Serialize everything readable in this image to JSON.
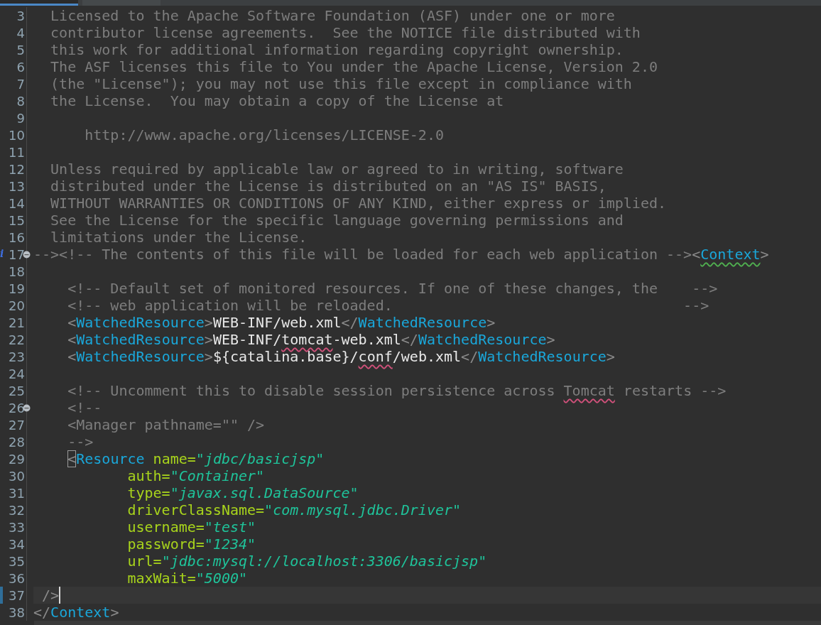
{
  "tabs": [
    {
      "selected": true
    },
    {
      "selected": false
    }
  ],
  "lines": [
    {
      "number": "3",
      "info": false,
      "fold": false,
      "current": false,
      "tokens": [
        {
          "kind": "comment",
          "t": "  Licensed to the Apache Software Foundation (ASF) under one or more"
        }
      ]
    },
    {
      "number": "4",
      "info": false,
      "fold": false,
      "current": false,
      "tokens": [
        {
          "kind": "comment",
          "t": "  contributor license agreements.  See the NOTICE file distributed with"
        }
      ]
    },
    {
      "number": "5",
      "info": false,
      "fold": false,
      "current": false,
      "tokens": [
        {
          "kind": "comment",
          "t": "  this work for additional information regarding copyright ownership."
        }
      ]
    },
    {
      "number": "6",
      "info": false,
      "fold": false,
      "current": false,
      "tokens": [
        {
          "kind": "comment",
          "t": "  The ASF licenses this file to You under the Apache License, Version 2.0"
        }
      ]
    },
    {
      "number": "7",
      "info": false,
      "fold": false,
      "current": false,
      "tokens": [
        {
          "kind": "comment",
          "t": "  (the \"License\"); you may not use this file except in compliance with"
        }
      ]
    },
    {
      "number": "8",
      "info": false,
      "fold": false,
      "current": false,
      "tokens": [
        {
          "kind": "comment",
          "t": "  the License.  You may obtain a copy of the License at"
        }
      ]
    },
    {
      "number": "9",
      "info": false,
      "fold": false,
      "current": false
    },
    {
      "number": "10",
      "info": false,
      "fold": false,
      "current": false,
      "tokens": [
        {
          "kind": "comment",
          "t": "      http://www.apache.org/licenses/LICENSE-2.0"
        }
      ]
    },
    {
      "number": "11",
      "info": false,
      "fold": false,
      "current": false
    },
    {
      "number": "12",
      "info": false,
      "fold": false,
      "current": false,
      "tokens": [
        {
          "kind": "comment",
          "t": "  Unless required by applicable law or agreed to in writing, software"
        }
      ]
    },
    {
      "number": "13",
      "info": false,
      "fold": false,
      "current": false,
      "tokens": [
        {
          "kind": "comment",
          "t": "  distributed under the License is distributed on an \"AS IS\" BASIS,"
        }
      ]
    },
    {
      "number": "14",
      "info": false,
      "fold": false,
      "current": false,
      "tokens": [
        {
          "kind": "comment",
          "t": "  WITHOUT WARRANTIES OR CONDITIONS OF ANY KIND, either express or implied."
        }
      ]
    },
    {
      "number": "15",
      "info": false,
      "fold": false,
      "current": false,
      "tokens": [
        {
          "kind": "comment",
          "t": "  See the License for the specific language governing permissions and"
        }
      ]
    },
    {
      "number": "16",
      "info": false,
      "fold": false,
      "current": false,
      "tokens": [
        {
          "kind": "comment",
          "t": "  limitations under the License."
        }
      ]
    },
    {
      "number": "17",
      "marker": "i",
      "info": true,
      "fold": true,
      "current": false,
      "tokens": [
        {
          "kind": "comment",
          "t": "--><!-- The contents of this file will be loaded for each web application -->"
        },
        {
          "kind": "punct",
          "t": "<"
        },
        {
          "kind": "tag-warn",
          "t": "Context"
        },
        {
          "kind": "punct",
          "t": ">"
        }
      ]
    },
    {
      "number": "18",
      "info": false,
      "fold": false,
      "current": false
    },
    {
      "number": "19",
      "info": false,
      "fold": false,
      "current": false,
      "tokens": [
        {
          "kind": "comment",
          "t": "    <!-- Default set of monitored resources. If one of these changes, the    -->"
        }
      ]
    },
    {
      "number": "20",
      "info": false,
      "fold": false,
      "current": false,
      "tokens": [
        {
          "kind": "comment",
          "t": "    <!-- web application will be reloaded.                                  -->"
        }
      ]
    },
    {
      "number": "21",
      "info": false,
      "fold": false,
      "current": false,
      "tokens": [
        {
          "kind": "punct",
          "t": "    <"
        },
        {
          "kind": "tag",
          "t": "WatchedResource"
        },
        {
          "kind": "punct",
          "t": ">"
        },
        {
          "kind": "text",
          "t": "WEB-INF/web.xml"
        },
        {
          "kind": "punct",
          "t": "</"
        },
        {
          "kind": "tag",
          "t": "WatchedResource"
        },
        {
          "kind": "punct",
          "t": ">"
        }
      ]
    },
    {
      "number": "22",
      "info": false,
      "fold": false,
      "current": false,
      "tokens": [
        {
          "kind": "punct",
          "t": "    <"
        },
        {
          "kind": "tag",
          "t": "WatchedResource"
        },
        {
          "kind": "punct",
          "t": ">"
        },
        {
          "kind": "text",
          "t": "WEB-INF/"
        },
        {
          "kind": "text-warn",
          "t": "tomcat"
        },
        {
          "kind": "text",
          "t": "-web.xml"
        },
        {
          "kind": "punct",
          "t": "</"
        },
        {
          "kind": "tag",
          "t": "WatchedResource"
        },
        {
          "kind": "punct",
          "t": ">"
        }
      ]
    },
    {
      "number": "23",
      "info": false,
      "fold": false,
      "current": false,
      "tokens": [
        {
          "kind": "punct",
          "t": "    <"
        },
        {
          "kind": "tag",
          "t": "WatchedResource"
        },
        {
          "kind": "punct",
          "t": ">"
        },
        {
          "kind": "text",
          "t": "${catalina.base}/"
        },
        {
          "kind": "text-warn",
          "t": "conf"
        },
        {
          "kind": "text",
          "t": "/web.xml"
        },
        {
          "kind": "punct",
          "t": "</"
        },
        {
          "kind": "tag",
          "t": "WatchedResource"
        },
        {
          "kind": "punct",
          "t": ">"
        }
      ]
    },
    {
      "number": "24",
      "info": false,
      "fold": false,
      "current": false
    },
    {
      "number": "25",
      "info": false,
      "fold": false,
      "current": false,
      "tokens": [
        {
          "kind": "comment",
          "t": "    <!-- Uncomment this to disable session persistence across "
        },
        {
          "kind": "comment-warn",
          "t": "Tomcat"
        },
        {
          "kind": "comment",
          "t": " restarts -->"
        }
      ]
    },
    {
      "number": "26",
      "info": false,
      "fold": true,
      "current": false,
      "tokens": [
        {
          "kind": "comment",
          "t": "    <!--"
        }
      ]
    },
    {
      "number": "27",
      "info": false,
      "fold": false,
      "current": false,
      "tokens": [
        {
          "kind": "comment",
          "t": "    <Manager pathname=\"\" />"
        }
      ]
    },
    {
      "number": "28",
      "info": false,
      "fold": false,
      "current": false,
      "tokens": [
        {
          "kind": "comment",
          "t": "    -->"
        }
      ]
    },
    {
      "number": "29",
      "info": false,
      "fold": false,
      "current": false,
      "tokens": [
        {
          "kind": "matched",
          "t": "    <"
        },
        {
          "kind": "tag",
          "t": "Resource"
        },
        {
          "kind": "attr",
          "t": " name="
        },
        {
          "kind": "value",
          "t": "\"jdbc/basicjsp\""
        }
      ]
    },
    {
      "number": "30",
      "info": false,
      "fold": false,
      "current": false,
      "tokens": [
        {
          "kind": "attr",
          "t": "           auth="
        },
        {
          "kind": "value",
          "t": "\"Container\""
        }
      ]
    },
    {
      "number": "31",
      "info": false,
      "fold": false,
      "current": false,
      "tokens": [
        {
          "kind": "attr",
          "t": "           type="
        },
        {
          "kind": "value",
          "t": "\"javax.sql.DataSource\""
        }
      ]
    },
    {
      "number": "32",
      "info": false,
      "fold": false,
      "current": false,
      "tokens": [
        {
          "kind": "attr",
          "t": "           driverClassName="
        },
        {
          "kind": "value",
          "t": "\"com.mysql.jdbc.Driver\""
        }
      ]
    },
    {
      "number": "33",
      "info": false,
      "fold": false,
      "current": false,
      "tokens": [
        {
          "kind": "attr",
          "t": "           username="
        },
        {
          "kind": "value",
          "t": "\"test\""
        }
      ]
    },
    {
      "number": "34",
      "info": false,
      "fold": false,
      "current": false,
      "tokens": [
        {
          "kind": "attr",
          "t": "           password="
        },
        {
          "kind": "value",
          "t": "\"1234\""
        }
      ]
    },
    {
      "number": "35",
      "info": false,
      "fold": false,
      "current": false,
      "tokens": [
        {
          "kind": "attr",
          "t": "           url="
        },
        {
          "kind": "value",
          "t": "\"jdbc:mysql://localhost:3306/basicjsp\""
        }
      ]
    },
    {
      "number": "36",
      "info": false,
      "fold": false,
      "current": false,
      "tokens": [
        {
          "kind": "attr",
          "t": "           maxWait="
        },
        {
          "kind": "value",
          "t": "\"5000\""
        }
      ]
    },
    {
      "number": "37",
      "info": false,
      "fold": false,
      "current": true,
      "tokens": [
        {
          "kind": "punct",
          "t": " />"
        }
      ]
    },
    {
      "number": "38",
      "info": false,
      "fold": false,
      "current": false,
      "tokens": [
        {
          "kind": "punct",
          "t": "</"
        },
        {
          "kind": "tag",
          "t": "Context"
        },
        {
          "kind": "punct",
          "t": ">"
        }
      ]
    }
  ]
}
